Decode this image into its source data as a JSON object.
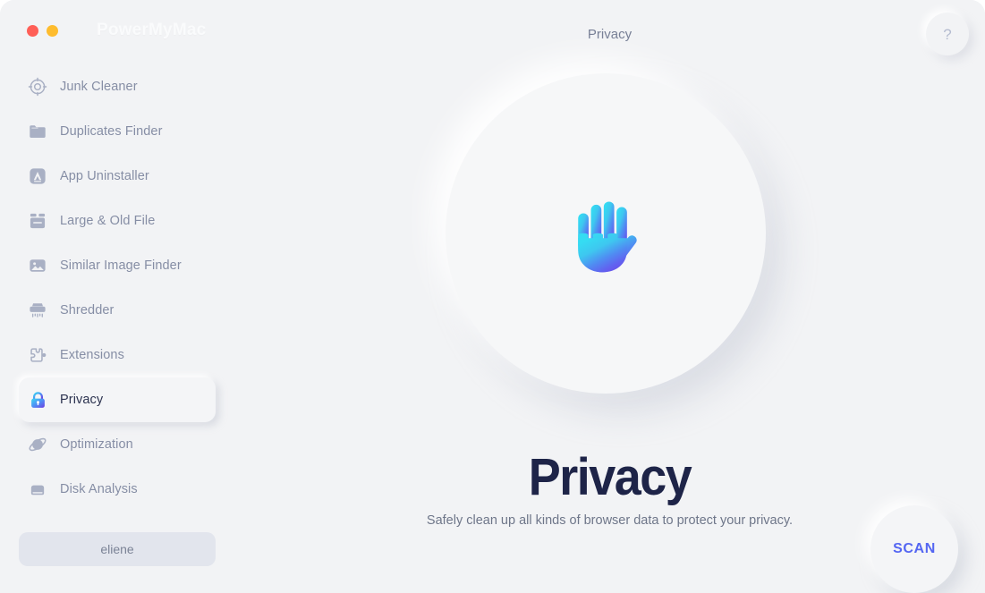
{
  "window": {
    "brand": "PowerMyMac",
    "controls": [
      {
        "name": "close",
        "color": "#ff5f57"
      },
      {
        "name": "minimize",
        "color": "#febc2e"
      }
    ]
  },
  "header": {
    "title": "Privacy",
    "help_label": "?"
  },
  "sidebar": {
    "items": [
      {
        "label": "Junk Cleaner",
        "icon": "junk-cleaner-icon",
        "active": false
      },
      {
        "label": "Duplicates Finder",
        "icon": "folder-icon",
        "active": false
      },
      {
        "label": "App Uninstaller",
        "icon": "app-uninstaller-icon",
        "active": false
      },
      {
        "label": "Large & Old File",
        "icon": "archive-box-icon",
        "active": false
      },
      {
        "label": "Similar Image Finder",
        "icon": "image-icon",
        "active": false
      },
      {
        "label": "Shredder",
        "icon": "shredder-icon",
        "active": false
      },
      {
        "label": "Extensions",
        "icon": "puzzle-piece-icon",
        "active": false
      },
      {
        "label": "Privacy",
        "icon": "lock-icon",
        "active": true
      },
      {
        "label": "Optimization",
        "icon": "planet-orbit-icon",
        "active": false
      },
      {
        "label": "Disk Analysis",
        "icon": "hard-drive-icon",
        "active": false
      }
    ],
    "account_label": "eliene"
  },
  "main": {
    "hero_icon": "raised-hand-icon",
    "heading": "Privacy",
    "subtitle": "Safely clean up all kinds of browser data to protect your privacy.",
    "scan_label": "SCAN"
  },
  "colors": {
    "background": "#f2f3f5",
    "accent_blue": "#5466f2",
    "gradient_start": "#3ad8f0",
    "gradient_end": "#6159ef",
    "text_dark": "#1e2448",
    "text_muted": "#868ea5",
    "traffic_close": "#ff5f57",
    "traffic_minimize": "#febc2e"
  }
}
